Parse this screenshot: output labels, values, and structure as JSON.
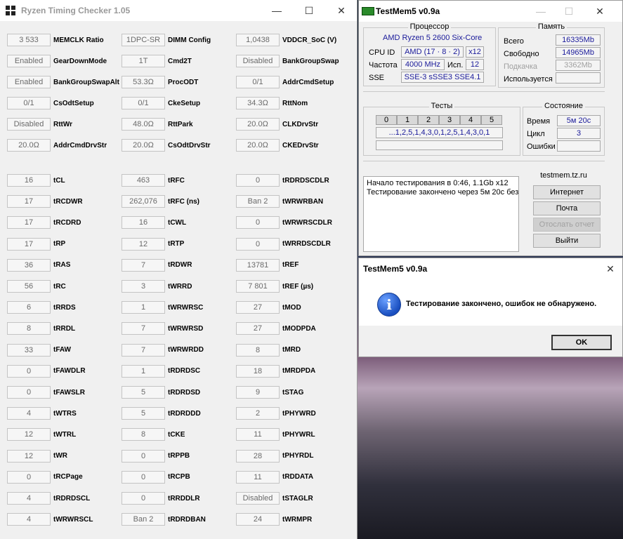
{
  "rtc": {
    "title": "Ryzen Timing Checker 1.05",
    "rows_top": [
      [
        {
          "v": "3 533",
          "l": "MEMCLK Ratio"
        },
        {
          "v": "1DPC-SR",
          "l": "DIMM Config"
        },
        {
          "v": "1,0438",
          "l": "VDDCR_SoC (V)"
        }
      ],
      [
        {
          "v": "Enabled",
          "l": "GearDownMode"
        },
        {
          "v": "1T",
          "l": "Cmd2T"
        },
        {
          "v": "Disabled",
          "l": "BankGroupSwap"
        }
      ],
      [
        {
          "v": "Enabled",
          "l": "BankGroupSwapAlt"
        },
        {
          "v": "53.3Ω",
          "l": "ProcODT"
        },
        {
          "v": "0/1",
          "l": "AddrCmdSetup"
        }
      ],
      [
        {
          "v": "0/1",
          "l": "CsOdtSetup"
        },
        {
          "v": "0/1",
          "l": "CkeSetup"
        },
        {
          "v": "34.3Ω",
          "l": "RttNom"
        }
      ],
      [
        {
          "v": "Disabled",
          "l": "RttWr"
        },
        {
          "v": "48.0Ω",
          "l": "RttPark"
        },
        {
          "v": "20.0Ω",
          "l": "CLKDrvStr"
        }
      ],
      [
        {
          "v": "20.0Ω",
          "l": "AddrCmdDrvStr"
        },
        {
          "v": "20.0Ω",
          "l": "CsOdtDrvStr"
        },
        {
          "v": "20.0Ω",
          "l": "CKEDrvStr"
        }
      ]
    ],
    "rows_timings": [
      [
        {
          "v": "16",
          "l": "tCL"
        },
        {
          "v": "463",
          "l": "tRFC"
        },
        {
          "v": "0",
          "l": "tRDRDSCDLR"
        }
      ],
      [
        {
          "v": "17",
          "l": "tRCDWR"
        },
        {
          "v": "262,076",
          "l": "tRFC (ns)"
        },
        {
          "v": "Ban 2",
          "l": "tWRWRBAN"
        }
      ],
      [
        {
          "v": "17",
          "l": "tRCDRD"
        },
        {
          "v": "16",
          "l": "tCWL"
        },
        {
          "v": "0",
          "l": "tWRWRSCDLR"
        }
      ],
      [
        {
          "v": "17",
          "l": "tRP"
        },
        {
          "v": "12",
          "l": "tRTP"
        },
        {
          "v": "0",
          "l": "tWRRDSCDLR"
        }
      ],
      [
        {
          "v": "36",
          "l": "tRAS"
        },
        {
          "v": "7",
          "l": "tRDWR"
        },
        {
          "v": "13781",
          "l": "tREF"
        }
      ],
      [
        {
          "v": "56",
          "l": "tRC"
        },
        {
          "v": "3",
          "l": "tWRRD"
        },
        {
          "v": "7 801",
          "l": "tREF (µs)"
        }
      ],
      [
        {
          "v": "6",
          "l": "tRRDS"
        },
        {
          "v": "1",
          "l": "tWRWRSC"
        },
        {
          "v": "27",
          "l": "tMOD"
        }
      ],
      [
        {
          "v": "8",
          "l": "tRRDL"
        },
        {
          "v": "7",
          "l": "tWRWRSD"
        },
        {
          "v": "27",
          "l": "tMODPDA"
        }
      ],
      [
        {
          "v": "33",
          "l": "tFAW"
        },
        {
          "v": "7",
          "l": "tWRWRDD"
        },
        {
          "v": "8",
          "l": "tMRD"
        }
      ],
      [
        {
          "v": "0",
          "l": "tFAWDLR"
        },
        {
          "v": "1",
          "l": "tRDRDSC"
        },
        {
          "v": "18",
          "l": "tMRDPDA"
        }
      ],
      [
        {
          "v": "0",
          "l": "tFAWSLR"
        },
        {
          "v": "5",
          "l": "tRDRDSD"
        },
        {
          "v": "9",
          "l": "tSTAG"
        }
      ],
      [
        {
          "v": "4",
          "l": "tWTRS"
        },
        {
          "v": "5",
          "l": "tRDRDDD"
        },
        {
          "v": "2",
          "l": "tPHYWRD"
        }
      ],
      [
        {
          "v": "12",
          "l": "tWTRL"
        },
        {
          "v": "8",
          "l": "tCKE"
        },
        {
          "v": "11",
          "l": "tPHYWRL"
        }
      ],
      [
        {
          "v": "12",
          "l": "tWR"
        },
        {
          "v": "0",
          "l": "tRPPB"
        },
        {
          "v": "28",
          "l": "tPHYRDL"
        }
      ],
      [
        {
          "v": "0",
          "l": "tRCPage"
        },
        {
          "v": "0",
          "l": "tRCPB"
        },
        {
          "v": "11",
          "l": "tRDDATA"
        }
      ],
      [
        {
          "v": "4",
          "l": "tRDRDSCL"
        },
        {
          "v": "0",
          "l": "tRRDDLR"
        },
        {
          "v": "Disabled",
          "l": "tSTAGLR"
        }
      ],
      [
        {
          "v": "4",
          "l": "tWRWRSCL"
        },
        {
          "v": "Ban 2",
          "l": "tRDRDBAN"
        },
        {
          "v": "24",
          "l": "tWRMPR"
        }
      ]
    ]
  },
  "tm5": {
    "title": "TestMem5 v0.9a",
    "cpu_group": "Процессор",
    "cpu_name": "AMD Ryzen 5 2600 Six-Core",
    "cpu_id_label": "CPU ID",
    "cpu_id": "AMD  (17 · 8 · 2)",
    "cpu_threads": "x12",
    "freq_label": "Частота",
    "freq": "4000 MHz",
    "used_label": "Исп.",
    "used": "12",
    "sse_label": "SSE",
    "sse": "SSE-3 sSSE3 SSE4.1",
    "mem_group": "Память",
    "total_label": "Всего",
    "total": "16335Mb",
    "free_label": "Свободно",
    "free": "14965Mb",
    "swap_label": "Подкачка",
    "swap": "3362Mb",
    "inuse_label": "Используется",
    "inuse": "",
    "tests_group": "Тесты",
    "test_numbers": [
      "0",
      "1",
      "2",
      "3",
      "4",
      "5"
    ],
    "test_seq": "...1,2,5,1,4,3,0,1,2,5,1,4,3,0,1",
    "status_group": "Состояние",
    "time_label": "Время",
    "time": "5м 20с",
    "cycle_label": "Цикл",
    "cycle": "3",
    "errors_label": "Ошибки",
    "errors": "",
    "log_line1": "Начало тестирования в 0:46, 1.1Gb x12",
    "log_line2": "Тестирование закончено через 5м 20с без",
    "site_group": "testmem.tz.ru",
    "btn_internet": "Интернет",
    "btn_mail": "Почта",
    "btn_report": "Отослать отчет",
    "btn_exit": "Выйти"
  },
  "dialog": {
    "title": "TestMem5 v0.9a",
    "message": "Тестирование закончено, ошибок не обнаружено.",
    "ok": "OK"
  }
}
